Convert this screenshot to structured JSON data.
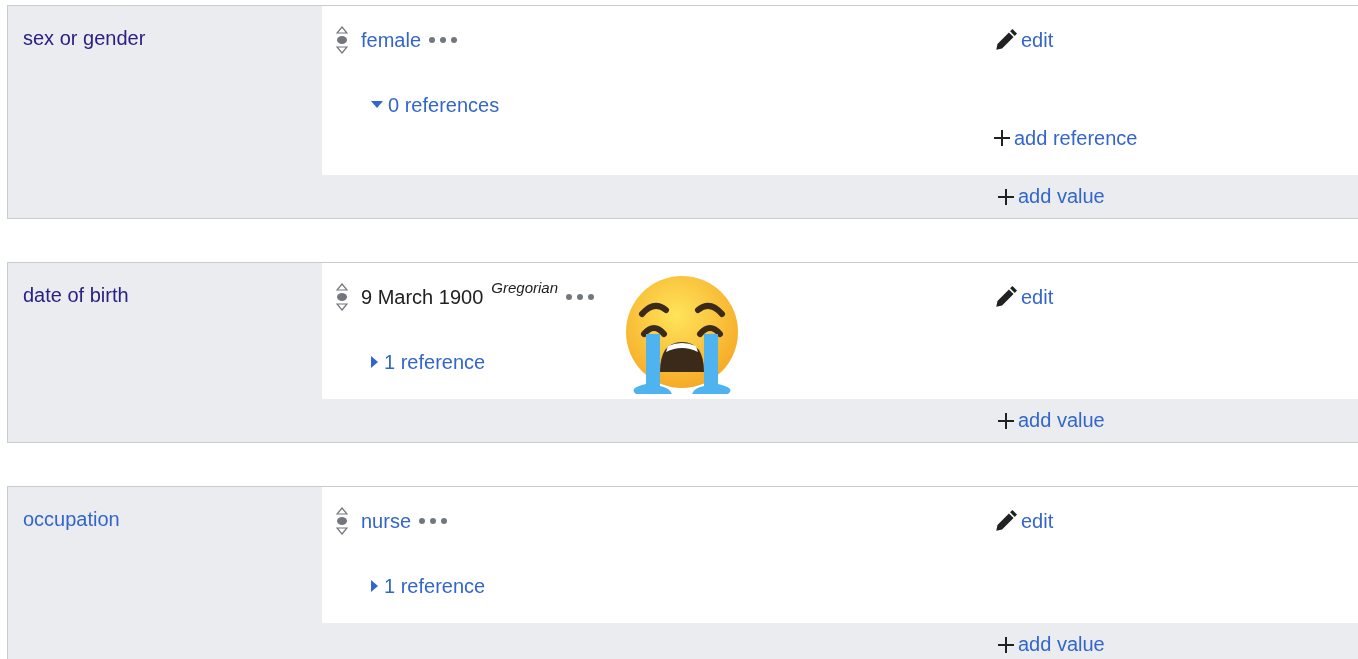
{
  "statement_groups": [
    {
      "property": "sex or gender",
      "visited": true,
      "value": {
        "kind": "link",
        "text": "female"
      },
      "edit": "edit",
      "references": {
        "label": "0 references",
        "expanded": true,
        "add": "add reference"
      },
      "add_value": "add value"
    },
    {
      "property": "date of birth",
      "visited": true,
      "value": {
        "kind": "time",
        "text": "9 March 1900",
        "calendar": "Gregorian"
      },
      "edit": "edit",
      "references": {
        "label": "1 reference",
        "expanded": false
      },
      "add_value": "add value"
    },
    {
      "property": "occupation",
      "visited": false,
      "value": {
        "kind": "link",
        "text": "nurse"
      },
      "edit": "edit",
      "references": {
        "label": "1 reference",
        "expanded": false
      },
      "add_value": "add value"
    }
  ]
}
